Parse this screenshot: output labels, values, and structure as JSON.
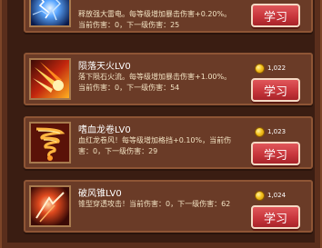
{
  "skills": [
    {
      "title": "",
      "description": "释放强大雷电。每等级增加暴击伤害+0.20%。当前伤害：0，下一级伤害：25",
      "cost": "",
      "button": "学习",
      "icon": "lightning-icon"
    },
    {
      "title": "陨落天火LV0",
      "description": "落下陨石火流。每等级增加暴击伤害+1.00%。当前伤害：0，下一级伤害：54",
      "cost": "1,022",
      "button": "学习",
      "icon": "fire-meteor-icon"
    },
    {
      "title": "嗜血龙卷LV0",
      "description": "血红龙卷风！每等级增加格挡+0.10%，当前伤害：0，下一级伤害：29",
      "cost": "1,023",
      "button": "学习",
      "icon": "blood-tornado-icon"
    },
    {
      "title": "破风锥LV0",
      "description": "锥型穿透攻击！当前伤害：0，下一级伤害：62",
      "cost": "1,024",
      "button": "学习",
      "icon": "wind-cone-icon"
    }
  ],
  "colors": {
    "button": "#c8363c",
    "card": "#6a3b27",
    "coin": "#f4c21e"
  }
}
